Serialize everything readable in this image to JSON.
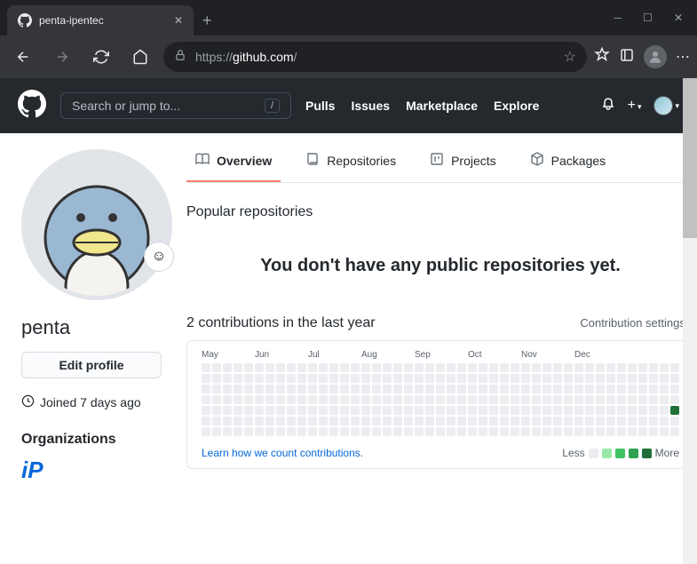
{
  "browser": {
    "tab_title": "penta-ipentec",
    "url_proto": "https://",
    "url_host": "github.com",
    "url_path": "/"
  },
  "gh_header": {
    "search_placeholder": "Search or jump to...",
    "slash": "/",
    "nav": {
      "pulls": "Pulls",
      "issues": "Issues",
      "marketplace": "Marketplace",
      "explore": "Explore"
    }
  },
  "profile": {
    "username": "penta",
    "edit_label": "Edit profile",
    "joined": "Joined 7 days ago",
    "orgs_heading": "Organizations",
    "org_name": "iP"
  },
  "tabs": {
    "overview": "Overview",
    "repositories": "Repositories",
    "projects": "Projects",
    "packages": "Packages"
  },
  "popular": {
    "heading": "Popular repositories",
    "empty": "You don't have any public repositories yet."
  },
  "contributions": {
    "count_text": "2 contributions in the last year",
    "settings": "Contribution settings ",
    "months": [
      "May",
      "Jun",
      "Jul",
      "Aug",
      "Sep",
      "Oct",
      "Nov",
      "Dec"
    ],
    "learn_link": "Learn how we count contributions.",
    "less": "Less",
    "more": "More",
    "legend_colors": [
      "#ebedf0",
      "#9be9a8",
      "#40c463",
      "#30a14e",
      "#216e39"
    ]
  }
}
